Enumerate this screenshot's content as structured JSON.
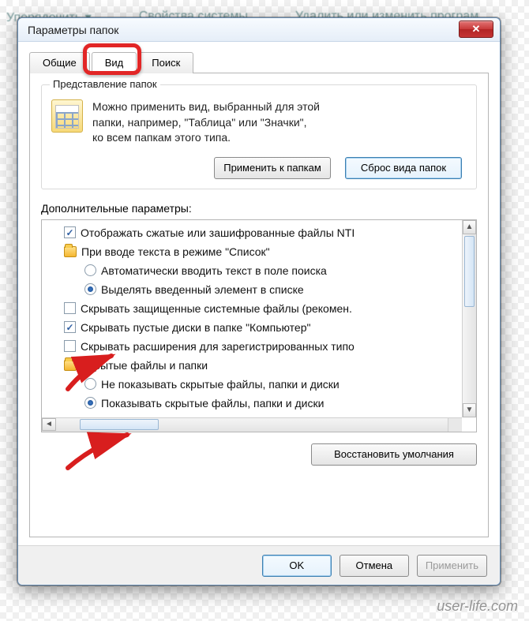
{
  "background": {
    "menu_items": [
      "Упорядочить ▾",
      "Свойства системы",
      "Удалить или изменить програм"
    ]
  },
  "dialog": {
    "title": "Параметры папок",
    "tabs": {
      "general": "Общие",
      "view": "Вид",
      "search": "Поиск",
      "active_index": 1
    },
    "group": {
      "title": "Представление папок",
      "text_line1": "Можно применить вид, выбранный для этой",
      "text_line2": "папки, например, \"Таблица\" или \"Значки\",",
      "text_line3": "ко всем папкам этого типа.",
      "apply_btn": "Применить к папкам",
      "reset_btn": "Сброс вида папок"
    },
    "advanced_label": "Дополнительные параметры:",
    "tree": [
      {
        "indent": 1,
        "ctrl": "cb",
        "checked": true,
        "text": "Отображать сжатые или зашифрованные файлы NTI"
      },
      {
        "indent": 1,
        "ctrl": "folder",
        "text": "При вводе текста в режиме \"Список\""
      },
      {
        "indent": 2,
        "ctrl": "rb",
        "checked": false,
        "text": "Автоматически вводить текст в поле поиска"
      },
      {
        "indent": 2,
        "ctrl": "rb",
        "checked": true,
        "text": "Выделять введенный элемент в списке"
      },
      {
        "indent": 1,
        "ctrl": "cb",
        "checked": false,
        "text": "Скрывать защищенные системные файлы (рекомен."
      },
      {
        "indent": 1,
        "ctrl": "cb",
        "checked": true,
        "text": "Скрывать пустые диски в папке \"Компьютер\""
      },
      {
        "indent": 1,
        "ctrl": "cb",
        "checked": false,
        "text": "Скрывать расширения для зарегистрированных типо"
      },
      {
        "indent": 1,
        "ctrl": "folder",
        "text": "Скрытые файлы и папки"
      },
      {
        "indent": 2,
        "ctrl": "rb",
        "checked": false,
        "text": "Не показывать скрытые файлы, папки и диски"
      },
      {
        "indent": 2,
        "ctrl": "rb",
        "checked": true,
        "text": "Показывать скрытые файлы, папки и диски"
      }
    ],
    "restore_defaults": "Восстановить умолчания",
    "footer": {
      "ok": "OK",
      "cancel": "Отмена",
      "apply": "Применить"
    }
  },
  "watermark": "user-life.com"
}
